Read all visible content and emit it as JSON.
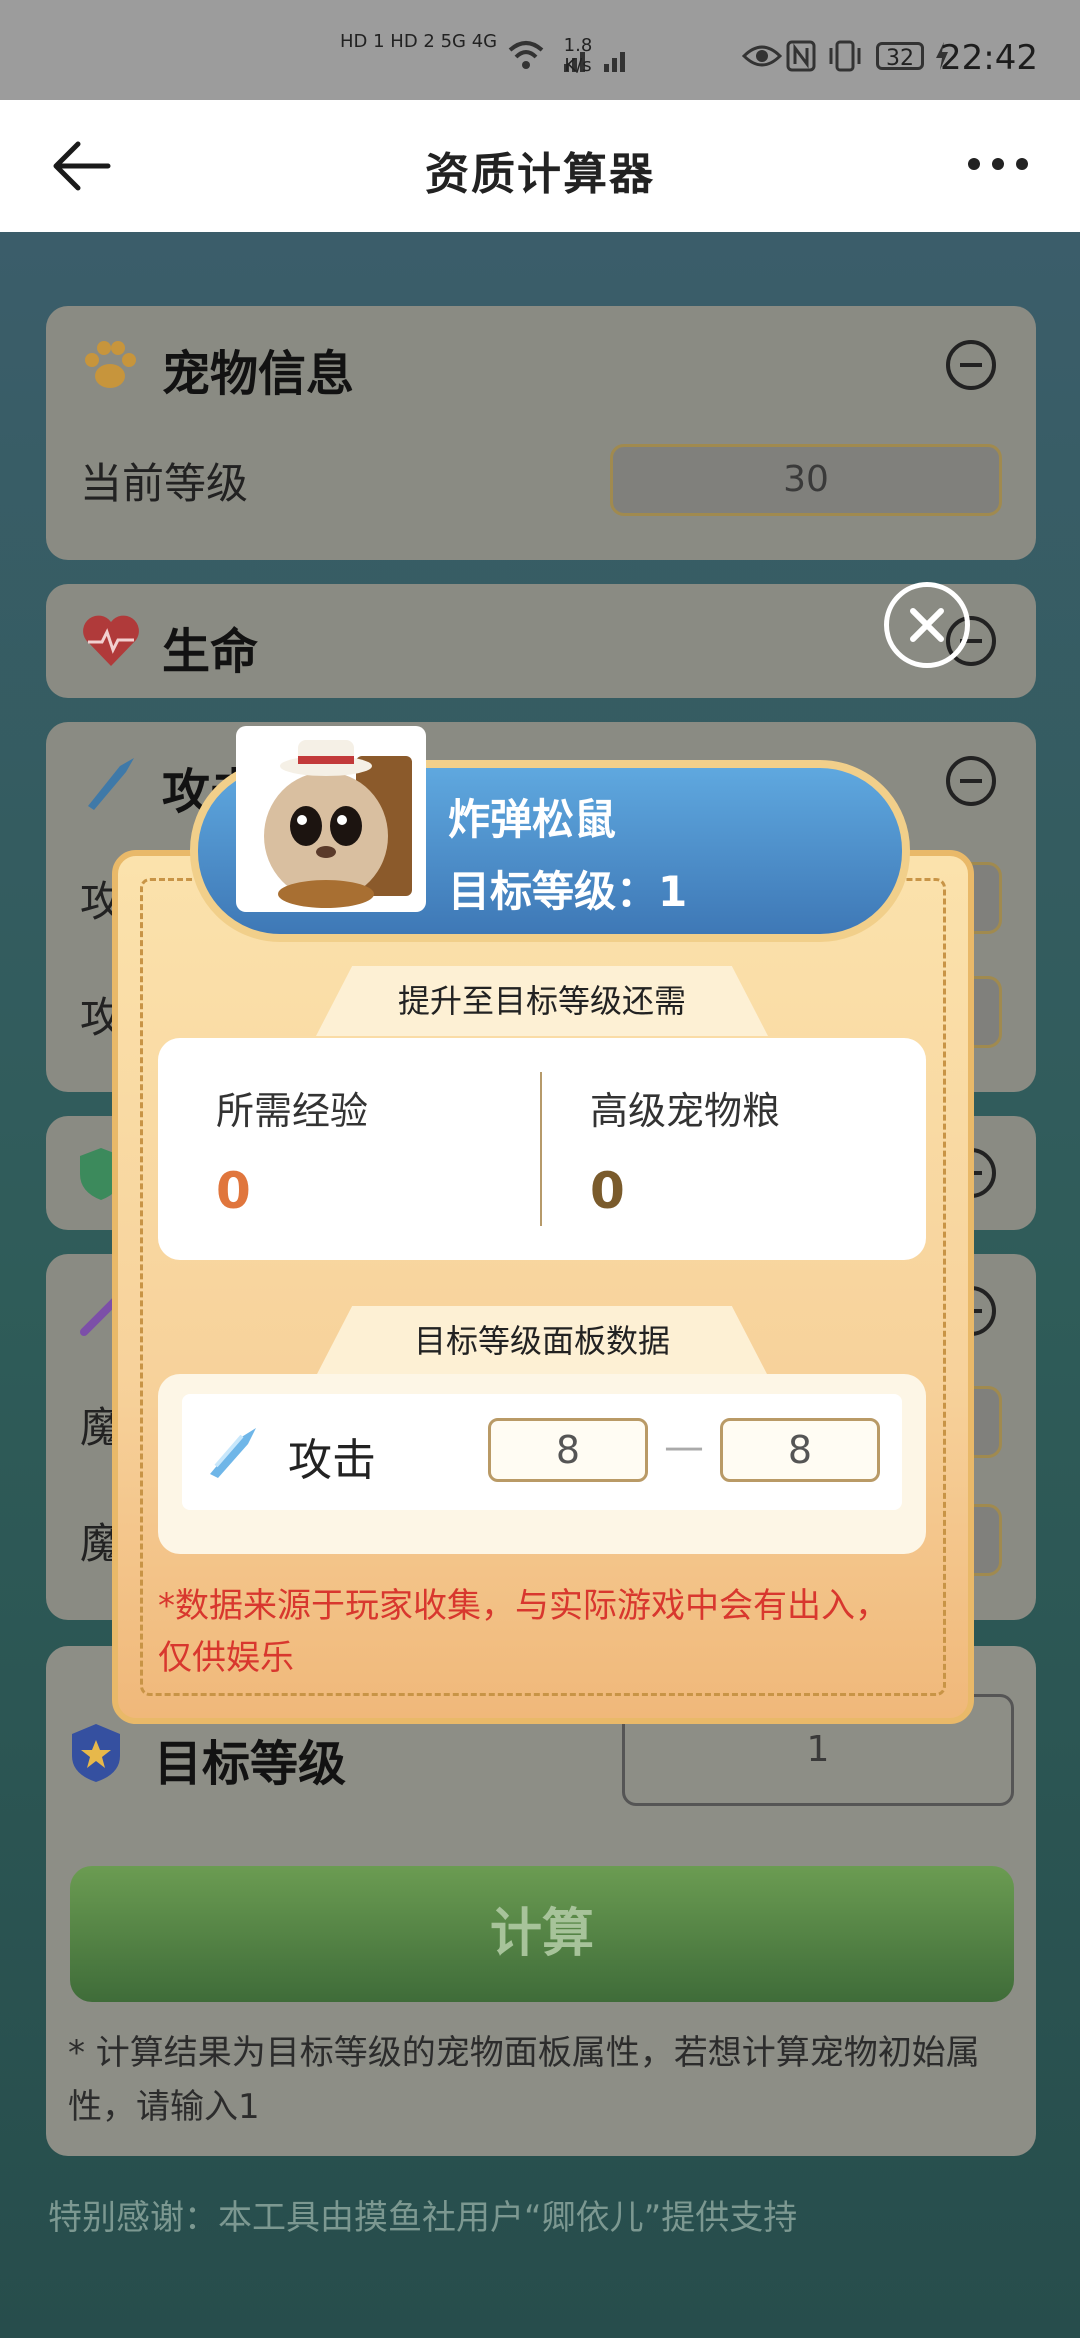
{
  "status_bar": {
    "network": "HD 1 HD 2 5G 4G",
    "speed": "1.8",
    "speed_unit": "K/s",
    "battery": "32",
    "time": "22:42"
  },
  "header": {
    "title": "资质计算器"
  },
  "pet_info": {
    "title": "宠物信息",
    "current_level_label": "当前等级",
    "current_level_value": "30"
  },
  "life": {
    "title": "生命"
  },
  "attack_card": {
    "title": "攻击",
    "row1_label": "攻",
    "row2_label": "攻"
  },
  "magic_card": {
    "row1_label": "魔",
    "row2_label": "魔"
  },
  "target": {
    "title": "目标等级",
    "value": "1"
  },
  "calc_button": "计算",
  "note": "* 计算结果为目标等级的宠物面板属性，若想计算宠物初始属性，请输入1",
  "thanks": "特别感谢：本工具由摸鱼社用户“卿依儿”提供支持",
  "modal": {
    "pet_name": "炸弹松鼠",
    "target_level_label": "目标等级：",
    "target_level_value": "1",
    "needed_title": "提升至目标等级还需",
    "exp_label": "所需经验",
    "exp_value": "0",
    "food_label": "高级宠物粮",
    "food_value": "0",
    "panel_title": "目标等级面板数据",
    "stat_label": "攻击",
    "stat_min": "8",
    "stat_separator": "—",
    "stat_max": "8",
    "disclaimer": "*数据来源于玩家收集，与实际游戏中会有出入，仅供娱乐"
  }
}
